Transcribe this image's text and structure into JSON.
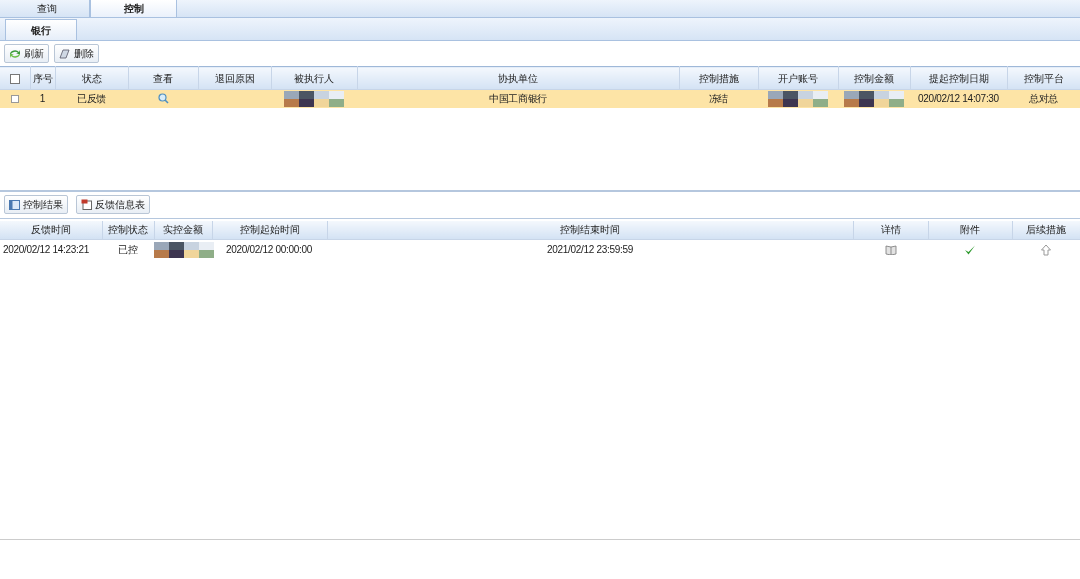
{
  "top_tabs": [
    {
      "label": "查询",
      "selected": false
    },
    {
      "label": "控制",
      "selected": true
    }
  ],
  "sub_tabs": [
    {
      "label": "银行",
      "selected": true
    }
  ],
  "toolbar": [
    {
      "label": "刷新"
    },
    {
      "label": "删除"
    }
  ],
  "control_table": {
    "select_all": {
      "checked": false
    },
    "columns": [
      "序号",
      "状态",
      "查看",
      "退回原因",
      "被执行人",
      "协执单位",
      "控制措施",
      "开户账号",
      "控制金额",
      "提起控制日期",
      "控制平台"
    ],
    "rows": [
      {
        "selected": true,
        "checked": false,
        "cells": [
          {
            "kind": "text",
            "text": "1"
          },
          {
            "kind": "text",
            "text": "已反馈"
          },
          {
            "kind": "magnifier"
          },
          {
            "kind": "blank"
          },
          {
            "kind": "redacted"
          },
          {
            "kind": "text",
            "text": "中国工商银行"
          },
          {
            "kind": "text",
            "text": "冻结"
          },
          {
            "kind": "redacted"
          },
          {
            "kind": "redacted"
          },
          {
            "kind": "text",
            "text": "020/02/12 14:07:30"
          },
          {
            "kind": "text",
            "text": "总对总"
          }
        ]
      }
    ]
  },
  "result_toolbar": [
    {
      "label": "控制结果"
    },
    {
      "label": "反馈信息表"
    }
  ],
  "result_table": {
    "columns": [
      "反馈时间",
      "控制状态",
      "实控金额",
      "控制起始时间",
      "控制结束时间",
      "详情",
      "附件",
      "后续措施"
    ],
    "rows": [
      {
        "cells": [
          {
            "kind": "text",
            "text": "2020/02/12 14:23:21"
          },
          {
            "kind": "text",
            "text": "已控"
          },
          {
            "kind": "redacted"
          },
          {
            "kind": "text",
            "text": "2020/02/12 00:00:00"
          },
          {
            "kind": "text",
            "text": "2021/02/12 23:59:59"
          },
          {
            "kind": "book"
          },
          {
            "kind": "check"
          },
          {
            "kind": "up_arrow"
          }
        ]
      }
    ]
  }
}
